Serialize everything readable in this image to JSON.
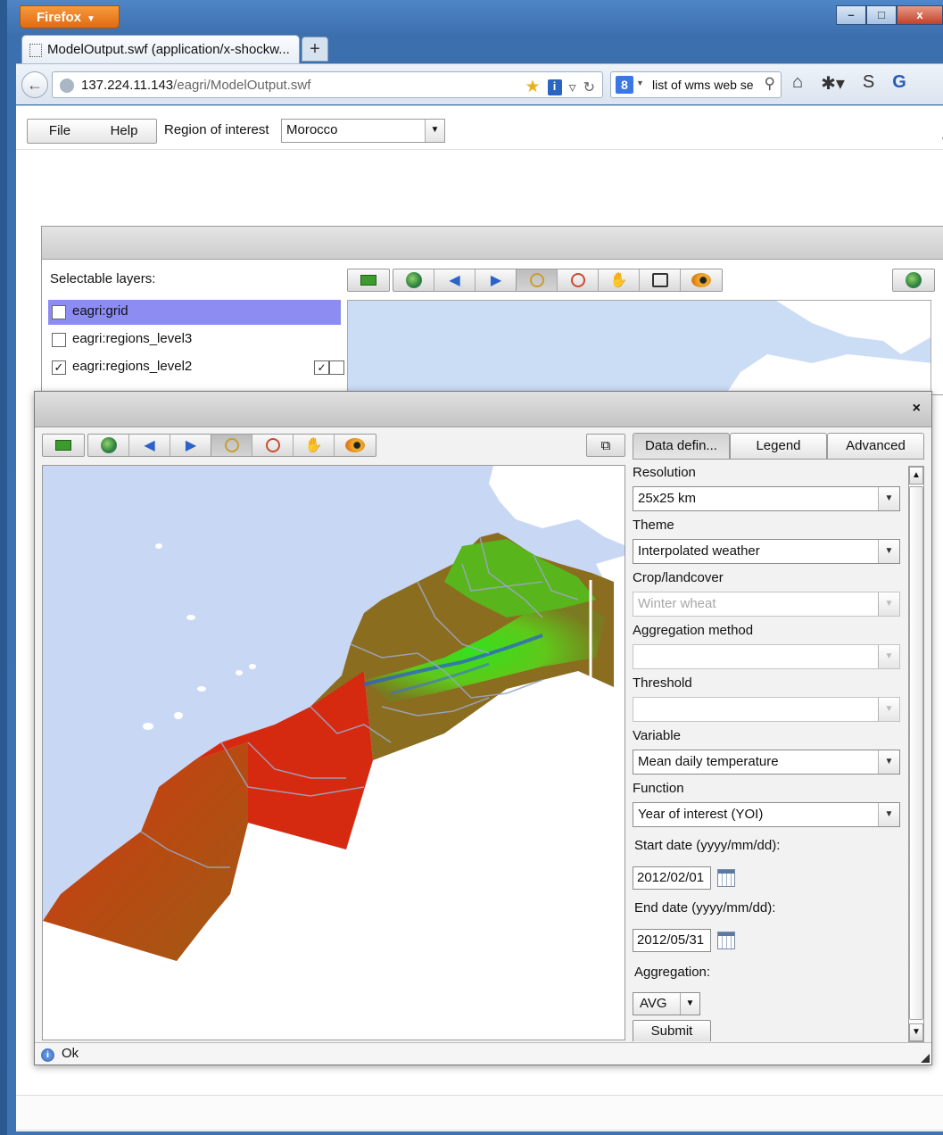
{
  "browser": {
    "menu_button": "Firefox",
    "tab_title": "ModelOutput.swf (application/x-shockw...",
    "new_tab": "+",
    "url_host": "137.224.11.143",
    "url_path": "/eagri/ModelOutput.swf",
    "search_text": "list of wms web se",
    "window_controls": {
      "minimize": "–",
      "maximize": "□",
      "close": "x"
    }
  },
  "app": {
    "menu": {
      "file": "File",
      "help": "Help"
    },
    "roi_label": "Region of interest",
    "roi_value": "Morocco",
    "cut_text": "\\"
  },
  "layers_panel": {
    "title": "Selectable layers:",
    "layers": [
      {
        "name": "eagri:grid",
        "checked": false,
        "selected": true
      },
      {
        "name": "eagri:regions_level3",
        "checked": false,
        "selected": false
      },
      {
        "name": "eagri:regions_level2",
        "checked": true,
        "selected": false
      }
    ]
  },
  "popup": {
    "close": "×",
    "tabs": [
      "Data defin...",
      "Legend",
      "Advanced"
    ],
    "form": {
      "resolution_label": "Resolution",
      "resolution_value": "25x25 km",
      "theme_label": "Theme",
      "theme_value": "Interpolated weather",
      "crop_label": "Crop/landcover",
      "crop_value": "Winter wheat",
      "aggregation_method_label": "Aggregation method",
      "aggregation_method_value": "",
      "threshold_label": "Threshold",
      "threshold_value": "",
      "variable_label": "Variable",
      "variable_value": "Mean daily temperature",
      "function_label": "Function",
      "function_value": "Year of interest (YOI)",
      "start_label": "Start date (yyyy/mm/dd):",
      "start_value": "2012/02/01",
      "end_label": "End date (yyyy/mm/dd):",
      "end_value": "2012/05/31",
      "aggregation_label": "Aggregation:",
      "aggregation_value": "AVG",
      "submit": "Submit"
    },
    "status_text": "Ok"
  },
  "colors": {
    "sea": "#c8d8f4",
    "land_other": "#ffffff",
    "heat_hot": "#e8200d",
    "heat_mid": "#8a7a22",
    "heat_cool": "#35e01c",
    "selected_layer": "#8c8cf2"
  }
}
